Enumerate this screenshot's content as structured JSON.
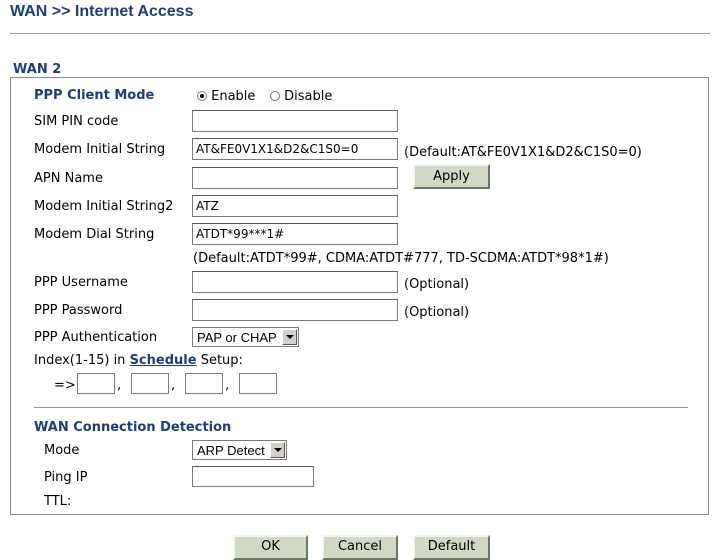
{
  "header": {
    "title": "WAN >> Internet Access",
    "section": "WAN 2"
  },
  "ppp": {
    "mode_label": "PPP Client Mode",
    "enable_label": "Enable",
    "disable_label": "Disable",
    "mode_selected": "Enable",
    "sim_pin_label": "SIM PIN code",
    "sim_pin_value": "",
    "modem_init_label": "Modem Initial String",
    "modem_init_value": "AT&FE0V1X1&D2&C1S0=0",
    "modem_init_default": "(Default:AT&FE0V1X1&D2&C1S0=0)",
    "apn_label": "APN Name",
    "apn_value": "",
    "apply_label": "Apply",
    "modem_init2_label": "Modem Initial String2",
    "modem_init2_value": "ATZ",
    "dial_label": "Modem Dial String",
    "dial_value": "ATDT*99***1#",
    "dial_default": "(Default:ATDT*99#, CDMA:ATDT#777, TD-SCDMA:ATDT*98*1#)",
    "username_label": "PPP Username",
    "username_value": "",
    "username_note": "(Optional)",
    "password_label": "PPP Password",
    "password_value": "",
    "password_note": "(Optional)",
    "auth_label": "PPP Authentication",
    "auth_value": "PAP or CHAP",
    "index_prefix": "Index(1-15) in",
    "schedule_link": "Schedule",
    "index_suffix": "Setup:",
    "index_arrow": "=>",
    "index_values": [
      "",
      "",
      "",
      ""
    ],
    "index_separator": ","
  },
  "detection": {
    "title": "WAN Connection Detection",
    "mode_label": "Mode",
    "mode_value": "ARP Detect",
    "ping_label": "Ping IP",
    "ping_value": "",
    "ttl_label": "TTL:"
  },
  "footer": {
    "ok_label": "OK",
    "cancel_label": "Cancel",
    "default_label": "Default"
  }
}
